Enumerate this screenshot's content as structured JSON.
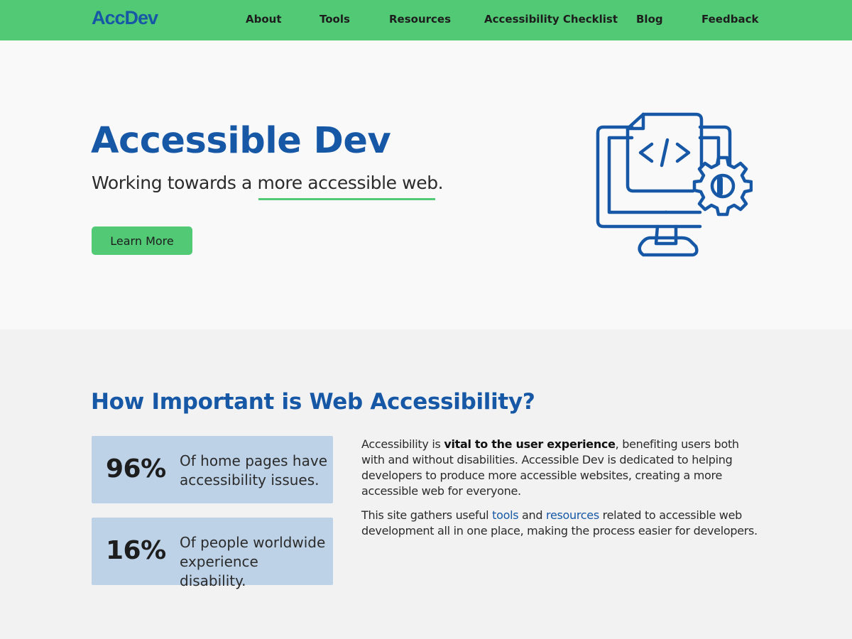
{
  "nav": {
    "logo": "AccDev",
    "links": [
      "About",
      "Tools",
      "Resources",
      "Accessibility Checklist",
      "Blog",
      "Feedback"
    ]
  },
  "hero": {
    "title": "Accessible Dev",
    "subtitle_before": "Working towards a ",
    "subtitle_highlight": "more accessible web",
    "subtitle_after": ".",
    "button_label": "Learn More",
    "icon": "monitor-code-gear-icon"
  },
  "importance": {
    "title": "How Important is Web Accessibility?",
    "stats": [
      {
        "number": "96%",
        "description": "Of home pages have accessibility issues."
      },
      {
        "number": "16%",
        "description": "Of people worldwide experience disability."
      }
    ],
    "para1": {
      "before": "Accessibility is ",
      "bold": "vital to the user experience",
      "after": ", benefiting users both with and without disabilities. Accessible Dev is dedicated to helping developers to produce more accessible websites, creating a more accessible web for everyone."
    },
    "para2": {
      "before": "This site gathers useful ",
      "link1": "tools",
      "middle": " and ",
      "link2": "resources",
      "after": " related to accessible web development all in one place, making the process easier for developers."
    }
  },
  "colors": {
    "nav_green": "#52c975",
    "brand_blue": "#1658a6",
    "stat_card_blue": "#bdd2e7",
    "hero_bg": "#f9f9f9",
    "section_bg": "#f2f2f2"
  }
}
